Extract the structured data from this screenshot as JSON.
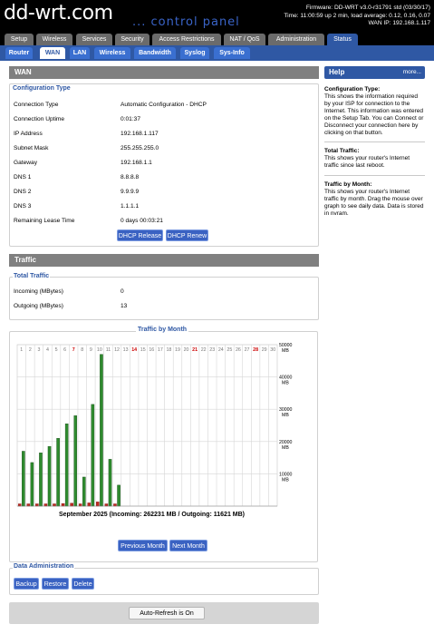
{
  "header": {
    "logo": "dd-wrt.com",
    "subtitle": "... control panel",
    "firmware": "Firmware: DD-WRT v3.0-r31791 std (03/30/17)",
    "time": "Time: 11:00:59 up 2 min, load average: 0.12, 0.16, 0.07",
    "wan_ip": "WAN IP: 192.168.1.117"
  },
  "main_tabs": [
    "Setup",
    "Wireless",
    "Services",
    "Security",
    "Access Restrictions",
    "NAT / QoS",
    "Administration",
    "Status"
  ],
  "sub_tabs": [
    "Router",
    "WAN",
    "LAN",
    "Wireless",
    "Bandwidth",
    "Syslog",
    "Sys-Info"
  ],
  "wan": {
    "section_title": "WAN",
    "config_title": "Configuration Type",
    "rows": [
      {
        "label": "Connection Type",
        "value": "Automatic Configuration - DHCP"
      },
      {
        "label": "Connection Uptime",
        "value": "0:01:37"
      },
      {
        "label": "IP Address",
        "value": "192.168.1.117"
      },
      {
        "label": "Subnet Mask",
        "value": "255.255.255.0"
      },
      {
        "label": "Gateway",
        "value": "192.168.1.1"
      },
      {
        "label": "DNS 1",
        "value": "8.8.8.8"
      },
      {
        "label": "DNS 2",
        "value": "9.9.9.9"
      },
      {
        "label": "DNS 3",
        "value": "1.1.1.1"
      },
      {
        "label": "Remaining Lease Time",
        "value": "0 days 00:03:21"
      }
    ],
    "dhcp_release": "DHCP Release",
    "dhcp_renew": "DHCP Renew"
  },
  "traffic": {
    "section_title": "Traffic",
    "total_title": "Total Traffic",
    "rows": [
      {
        "label": "Incoming (MBytes)",
        "value": "0"
      },
      {
        "label": "Outgoing (MBytes)",
        "value": "13"
      }
    ],
    "month_title": "Traffic by Month",
    "prev_month": "Previous Month",
    "next_month": "Next Month"
  },
  "data_admin": {
    "title": "Data Administration",
    "backup": "Backup",
    "restore": "Restore",
    "delete": "Delete"
  },
  "auto_refresh": "Auto-Refresh is On",
  "help": {
    "title": "Help",
    "more": "more...",
    "sections": [
      {
        "title": "Configuration Type:",
        "text": "This shows the information required by your ISP for connection to the Internet. This information was entered on the Setup Tab. You can Connect or Disconnect your connection here by clicking on that button."
      },
      {
        "title": "Total Traffic:",
        "text": "This shows your router's Internet traffic since last reboot."
      },
      {
        "title": "Traffic by Month:",
        "text": "This shows your router's Internet traffic by month. Drag the mouse over graph to see daily data. Data is stored in nvram."
      }
    ]
  },
  "colors": {
    "incoming": "#2e8b2e",
    "outgoing": "#c0281f",
    "weekend_label": "#cc0000",
    "tab_active": "#2f58a4"
  },
  "chart_data": {
    "type": "bar",
    "title": "",
    "caption": "September 2025 (Incoming: 262231 MB / Outgoing: 11621 MB)",
    "days": [
      "1",
      "2",
      "3",
      "4",
      "5",
      "6",
      "7",
      "8",
      "9",
      "10",
      "11",
      "12",
      "13",
      "14",
      "15",
      "16",
      "17",
      "18",
      "19",
      "20",
      "21",
      "22",
      "23",
      "24",
      "25",
      "26",
      "27",
      "28",
      "29",
      "30"
    ],
    "red_days": [
      "7",
      "14",
      "21",
      "28"
    ],
    "y_labels": [
      "50000 MB",
      "40000 MB",
      "30000 MB",
      "20000 MB",
      "10000 MB"
    ],
    "ylim": [
      0,
      50000
    ],
    "series": [
      {
        "name": "Incoming",
        "values": [
          17000,
          13500,
          16500,
          18500,
          21000,
          25500,
          28000,
          9000,
          31500,
          47000,
          14500,
          6500,
          0,
          0,
          0,
          0,
          0,
          0,
          0,
          0,
          0,
          0,
          0,
          0,
          0,
          0,
          0,
          0,
          0,
          0
        ]
      },
      {
        "name": "Outgoing",
        "values": [
          700,
          700,
          700,
          700,
          700,
          800,
          900,
          400,
          1000,
          1300,
          500,
          300,
          0,
          0,
          0,
          0,
          0,
          0,
          0,
          0,
          0,
          0,
          0,
          0,
          0,
          0,
          0,
          0,
          0,
          0
        ]
      }
    ]
  }
}
